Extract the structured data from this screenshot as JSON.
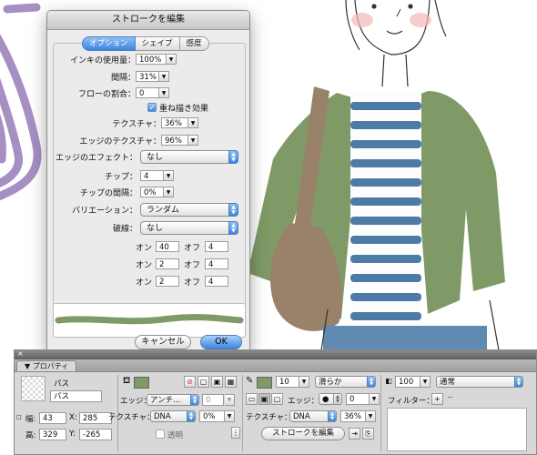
{
  "dialog": {
    "title": "ストロークを編集",
    "tabs": [
      {
        "label": "オプション",
        "active": true
      },
      {
        "label": "シェイプ",
        "active": false
      },
      {
        "label": "感度",
        "active": false
      }
    ],
    "ink_usage": {
      "label": "インキの使用量：",
      "value": "100%"
    },
    "spacing": {
      "label": "間隔：",
      "value": "31%"
    },
    "flow": {
      "label": "フローの割合：",
      "value": "0"
    },
    "overprint": {
      "label": "重ね描き効果",
      "checked": true
    },
    "texture": {
      "label": "テクスチャ：",
      "value": "36%"
    },
    "edge_texture": {
      "label": "エッジのテクスチャ：",
      "value": "96%"
    },
    "edge_effect": {
      "label": "エッジのエフェクト：",
      "value": "なし"
    },
    "tips": {
      "label": "チップ：",
      "value": "4"
    },
    "tip_spacing": {
      "label": "チップの間隔：",
      "value": "0%"
    },
    "variation": {
      "label": "バリエーション：",
      "value": "ランダム"
    },
    "dash": {
      "label": "破線：",
      "value": "なし"
    },
    "dash_rows": [
      {
        "on_label": "オン",
        "on": "40",
        "off_label": "オフ",
        "off": "4"
      },
      {
        "on_label": "オン",
        "on": "2",
        "off_label": "オフ",
        "off": "4"
      },
      {
        "on_label": "オン",
        "on": "2",
        "off_label": "オフ",
        "off": "4"
      }
    ],
    "cancel_label": "キャンセル",
    "ok_label": "OK"
  },
  "properties": {
    "tab_label": "プロパティ",
    "object": {
      "type": "パス",
      "name": "パス"
    },
    "geometry": {
      "w_label": "幅:",
      "w": "43",
      "x_label": "X:",
      "x": "285",
      "h_label": "高:",
      "h": "329",
      "y_label": "Y:",
      "y": "-265"
    },
    "fill": {
      "color": "#7f9a66",
      "edge_label": "エッジ：",
      "edge_value": "アンチ...",
      "edge_amount": "0",
      "texture_label": "テクスチャ：",
      "texture_value": "DNA",
      "texture_amount": "0%",
      "transparent_label": "透明"
    },
    "stroke": {
      "color": "#7f9a66",
      "size": "10",
      "category": "滑らか",
      "edge_label": "エッジ：",
      "edge_amount": "0",
      "texture_label": "テクスチャ：",
      "texture_value": "DNA",
      "texture_amount": "36%",
      "edit_stroke_label": "ストロークを編集"
    },
    "effects": {
      "opacity": "100",
      "blend_mode": "通常",
      "filter_label": "フィルター："
    }
  },
  "colors": {
    "accent": "#3d84dd",
    "jacket": "#7f9a66",
    "stripes": "#4e7ba6",
    "bag": "#9a8169",
    "lavender": "#a68fc2"
  }
}
